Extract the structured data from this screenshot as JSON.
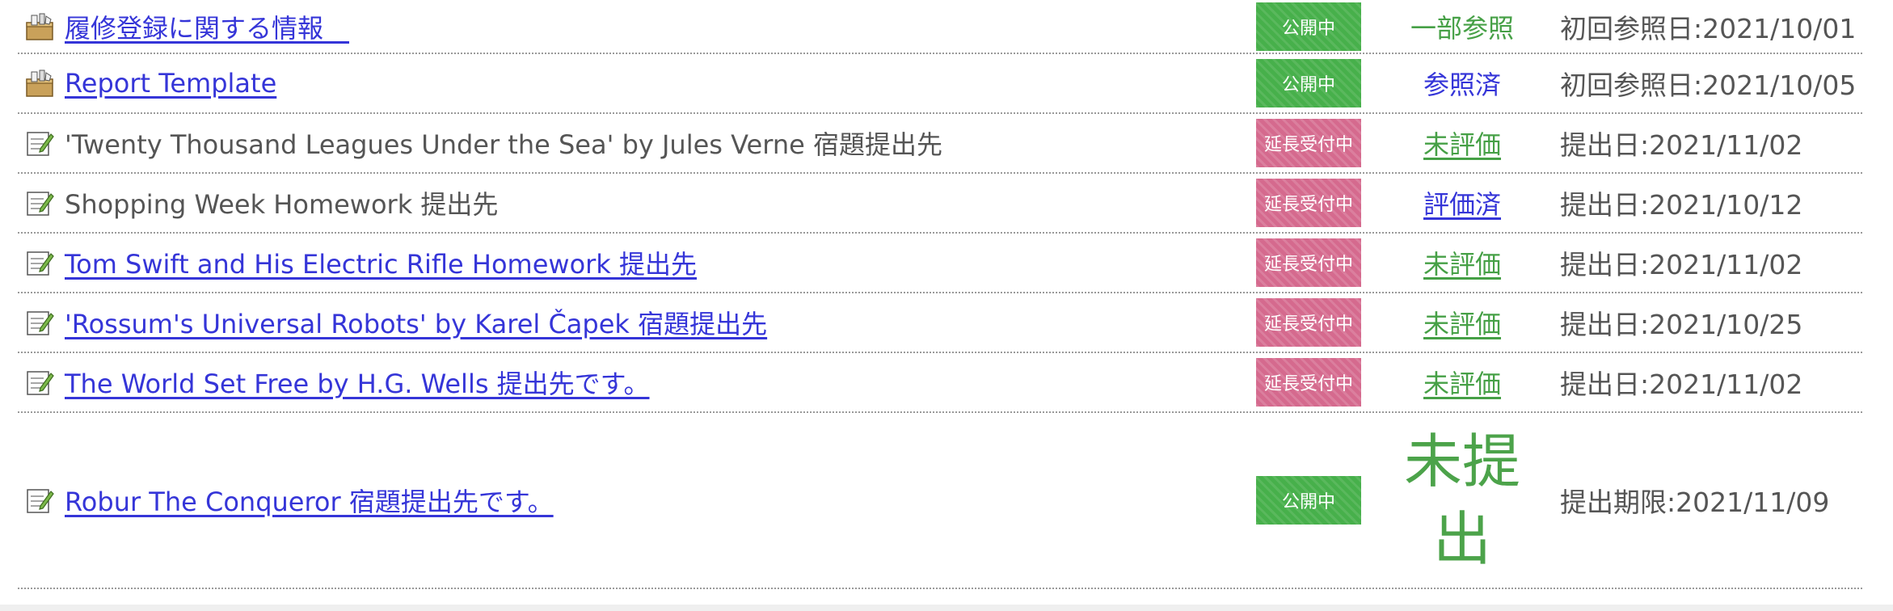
{
  "rows": [
    {
      "title": "履修登録に関する情報　",
      "title_style": "link",
      "icon": "toolbox-icon",
      "badge": "公開中",
      "badge_type": "public",
      "status": "一部参照",
      "status_style": "green",
      "date": "初回参照日:2021/10/01"
    },
    {
      "title": "Report Template",
      "title_style": "link",
      "icon": "toolbox-icon",
      "badge": "公開中",
      "badge_type": "public",
      "status": "参照済",
      "status_style": "blue",
      "date": "初回参照日:2021/10/05"
    },
    {
      "title": "'Twenty Thousand Leagues Under the Sea' by Jules Verne 宿題提出先",
      "title_style": "plain",
      "icon": "assignment-icon",
      "badge": "延長受付中",
      "badge_type": "ext",
      "status": "未評価",
      "status_style": "green-link",
      "date": "提出日:2021/11/02"
    },
    {
      "title": "Shopping Week Homework 提出先",
      "title_style": "plain",
      "icon": "assignment-icon",
      "badge": "延長受付中",
      "badge_type": "ext",
      "status": "評価済",
      "status_style": "blue-link",
      "date": "提出日:2021/10/12"
    },
    {
      "title": "Tom Swift and His Electric Rifle Homework 提出先",
      "title_style": "link",
      "icon": "assignment-icon",
      "badge": "延長受付中",
      "badge_type": "ext",
      "status": "未評価",
      "status_style": "green-link",
      "date": "提出日:2021/11/02"
    },
    {
      "title": "'Rossum's Universal Robots' by Karel Čapek 宿題提出先",
      "title_style": "link",
      "icon": "assignment-icon",
      "badge": "延長受付中",
      "badge_type": "ext",
      "status": "未評価",
      "status_style": "green-link",
      "date": "提出日:2021/10/25"
    },
    {
      "title": "The World Set Free by H.G. Wells 提出先です。",
      "title_style": "link",
      "icon": "assignment-icon",
      "badge": "延長受付中",
      "badge_type": "ext",
      "status": "未評価",
      "status_style": "green-link",
      "date": "提出日:2021/11/02"
    },
    {
      "title": "Robur The Conqueror 宿題提出先です。",
      "title_style": "link",
      "icon": "assignment-icon",
      "badge": "公開中",
      "badge_type": "public",
      "status": "未提出",
      "status_style": "big",
      "date": "提出期限:2021/11/09"
    }
  ],
  "colors": {
    "link": "#3535d8",
    "public_badge": "#47b04b",
    "ext_badge": "#d56a8e",
    "status_green": "#46a046"
  }
}
